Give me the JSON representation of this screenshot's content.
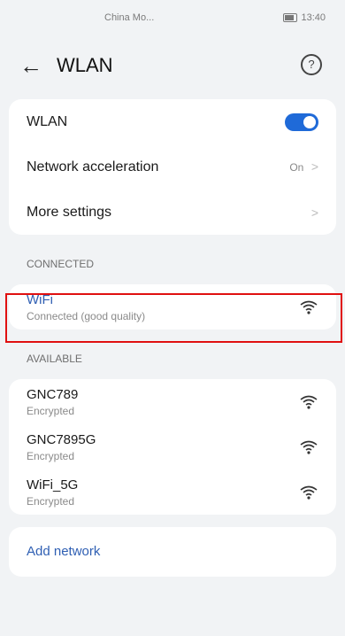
{
  "status_bar": {
    "carrier": "China Mo...",
    "signal_icons": "▦ ⁴ᴳ ⌇ ≋",
    "time": "13:40"
  },
  "header": {
    "title": "WLAN",
    "back_icon": "arrow-left-icon",
    "help_icon": "help-icon"
  },
  "settings": {
    "wlan_label": "WLAN",
    "wlan_enabled": true,
    "accel_label": "Network acceleration",
    "accel_value": "On",
    "more_label": "More settings"
  },
  "connected": {
    "section_label": "CONNECTED",
    "name": "WiFi",
    "status": "Connected (good quality)"
  },
  "available": {
    "section_label": "AVAILABLE",
    "networks": [
      {
        "name": "GNC789",
        "status": "Encrypted"
      },
      {
        "name": "GNC7895G",
        "status": "Encrypted"
      },
      {
        "name": "WiFi_5G",
        "status": "Encrypted"
      }
    ]
  },
  "add_network_label": "Add network",
  "colors": {
    "accent": "#1f6ad8",
    "link": "#2f5fb3",
    "highlight": "#e01010"
  }
}
